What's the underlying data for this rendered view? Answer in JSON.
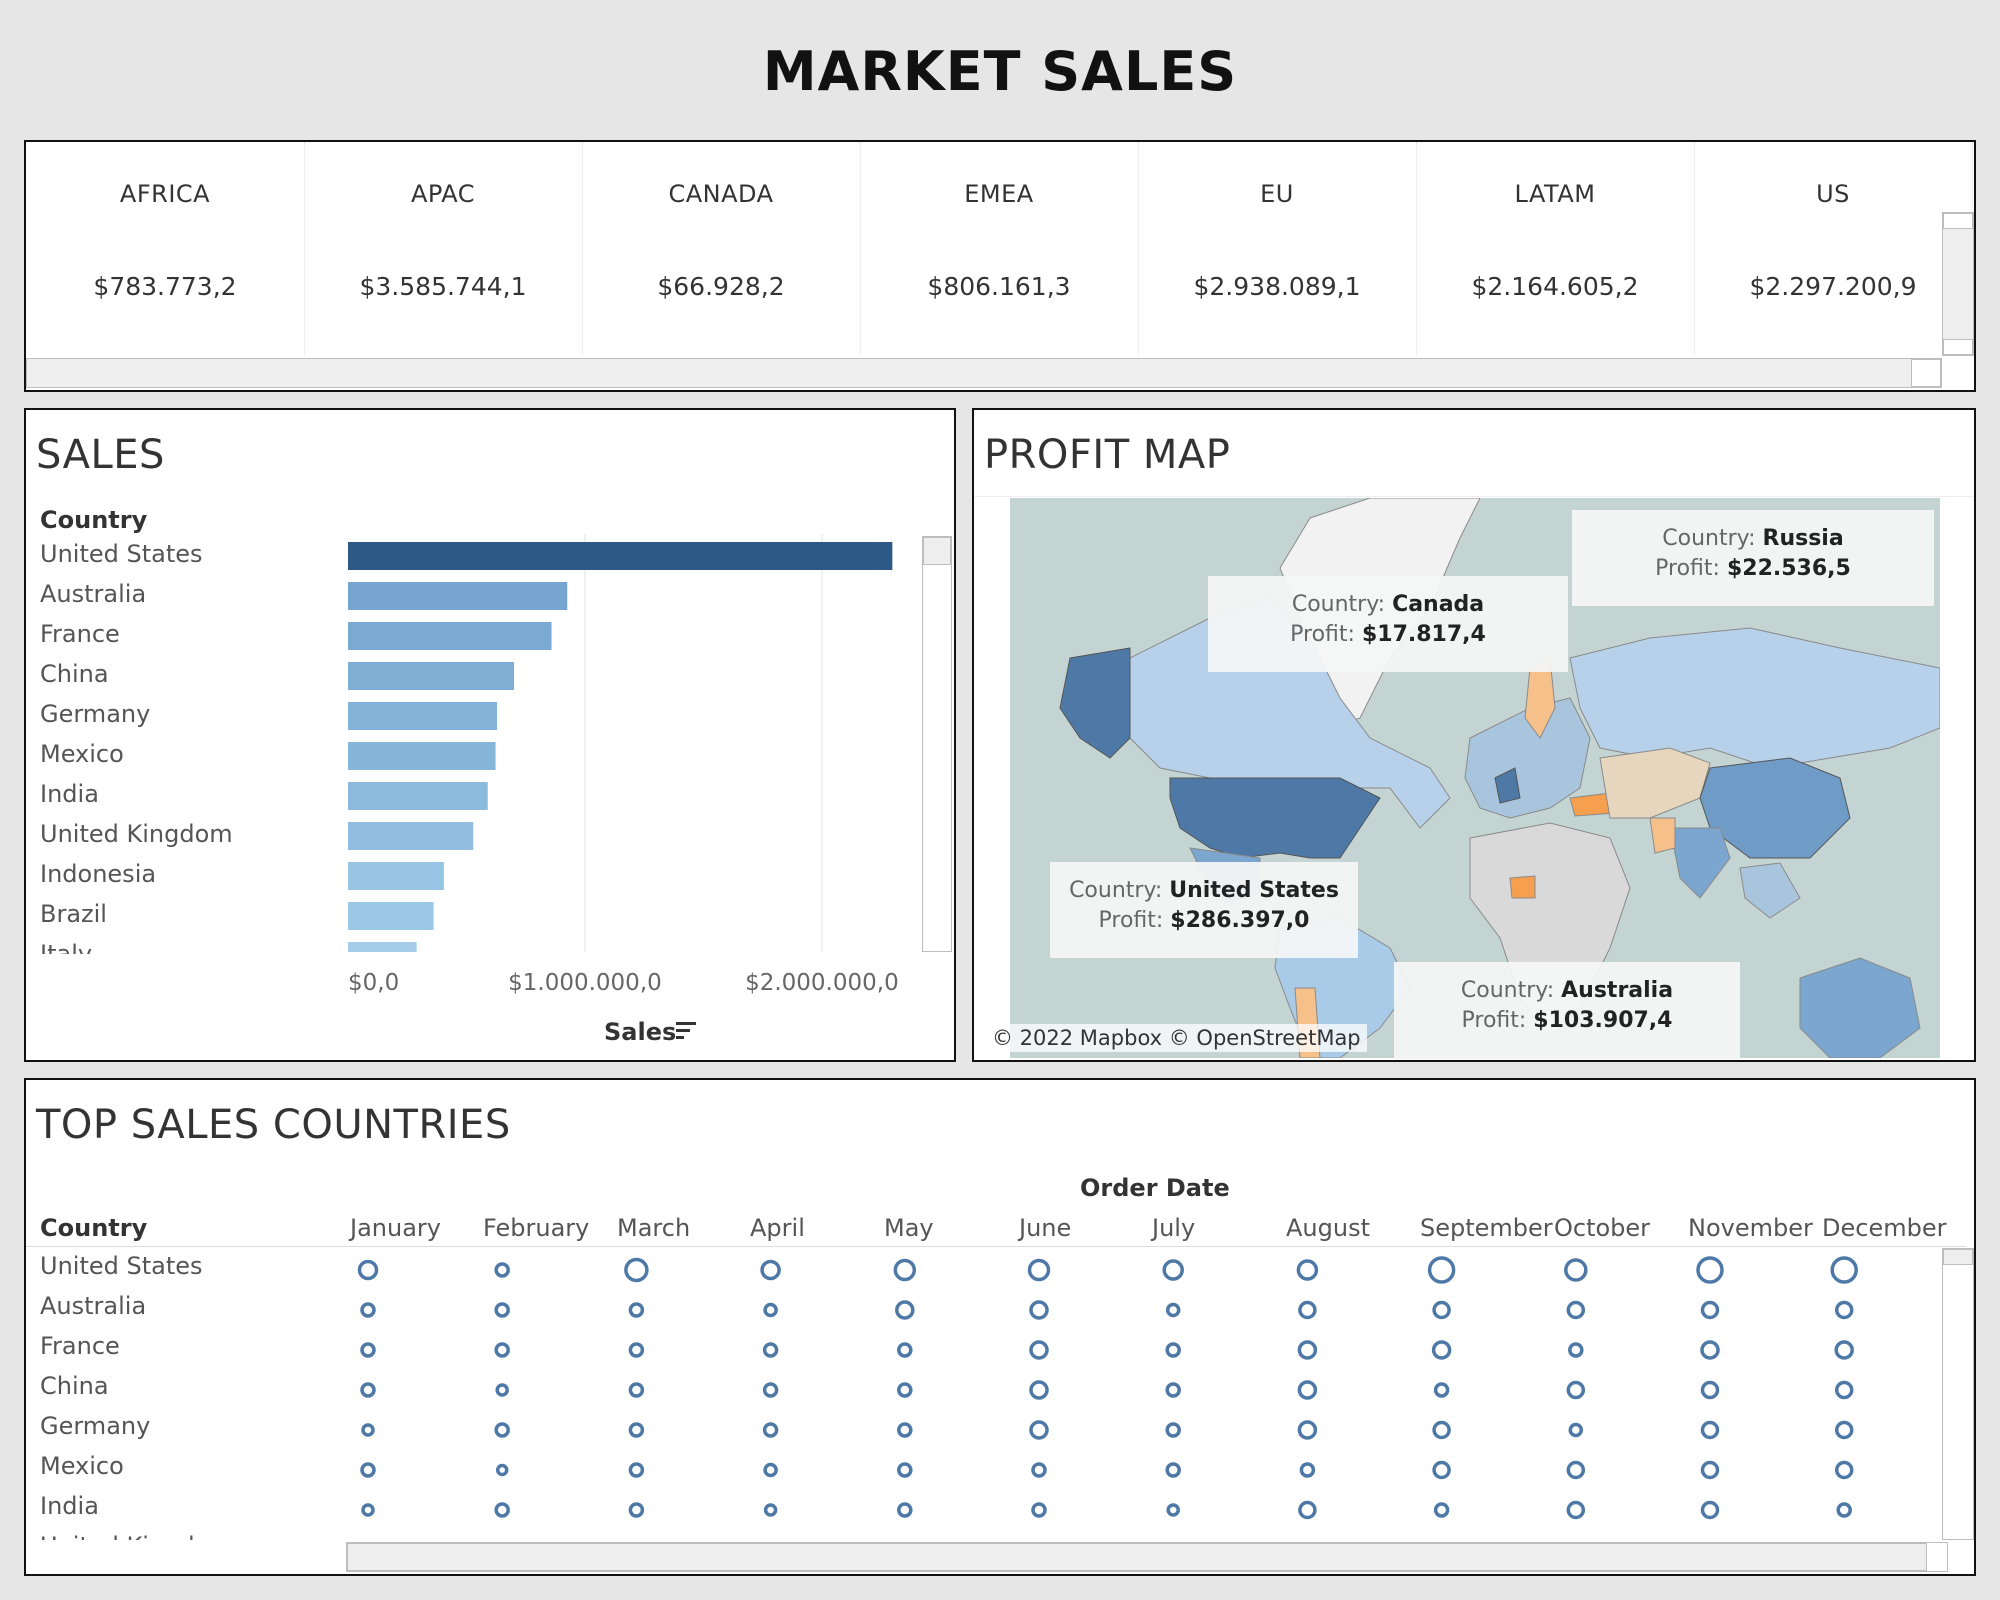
{
  "title": "MARKET SALES",
  "kpi": [
    {
      "region": "AFRICA",
      "value": "$783.773,2"
    },
    {
      "region": "APAC",
      "value": "$3.585.744,1"
    },
    {
      "region": "CANADA",
      "value": "$66.928,2"
    },
    {
      "region": "EMEA",
      "value": "$806.161,3"
    },
    {
      "region": "EU",
      "value": "$2.938.089,1"
    },
    {
      "region": "LATAM",
      "value": "$2.164.605,2"
    },
    {
      "region": "US",
      "value": "$2.297.200,9"
    }
  ],
  "sales": {
    "title": "SALES",
    "column_header": "Country",
    "axis_title": "Sales",
    "sort_icon": "sort-descending-icon",
    "chart_data": {
      "type": "bar",
      "categories": [
        "United States",
        "Australia",
        "France",
        "China",
        "Germany",
        "Mexico",
        "India",
        "United Kingdom",
        "Indonesia",
        "Brazil",
        "Italy"
      ],
      "values": [
        2297201,
        925236,
        858931,
        700562,
        628840,
        622591,
        589650,
        528576,
        404888,
        361107,
        289709
      ],
      "xlabel": "Sales",
      "xlim": [
        0,
        2300000
      ],
      "ticks": [
        "$0,0",
        "$1.000.000,0",
        "$2.000.000,0"
      ],
      "tick_values": [
        0,
        1000000,
        2000000
      ],
      "bar_colors": [
        "#2c5985",
        "#76a6cf",
        "#7aa9d2",
        "#80afd6",
        "#84b3d9",
        "#86b5da",
        "#8bbadd",
        "#90bde0",
        "#99c5e5",
        "#9cc8e7",
        "#a5cdea"
      ]
    }
  },
  "map": {
    "title": "PROFIT MAP",
    "credit": "© 2022 Mapbox © OpenStreetMap",
    "tooltips": [
      {
        "country_label": "Country:",
        "country": "Russia",
        "profit_label": "Profit:",
        "profit": "$22.536,5"
      },
      {
        "country_label": "Country:",
        "country": "Canada",
        "profit_label": "Profit:",
        "profit": "$17.817,4"
      },
      {
        "country_label": "Country:",
        "country": "United States",
        "profit_label": "Profit:",
        "profit": "$286.397,0"
      },
      {
        "country_label": "Country:",
        "country": "Australia",
        "profit_label": "Profit:",
        "profit": "$103.907,4"
      }
    ],
    "colors": {
      "ocean": "#c3d4d2",
      "land": "#d9d9d9",
      "high": "#4e79a7",
      "mid": "#a3c4e2",
      "loss": "#f59f4f"
    }
  },
  "top_sales": {
    "title": "TOP SALES COUNTRIES",
    "column_header": "Country",
    "date_header": "Order Date",
    "months": [
      "January",
      "February",
      "March",
      "April",
      "May",
      "June",
      "July",
      "August",
      "September",
      "October",
      "November",
      "December"
    ],
    "countries": [
      "United States",
      "Australia",
      "France",
      "China",
      "Germany",
      "Mexico",
      "India",
      "United Kingdom"
    ],
    "chart_data": {
      "type": "scatter",
      "rows": [
        "United States",
        "Australia",
        "France",
        "China",
        "Germany",
        "Mexico",
        "India"
      ],
      "columns": [
        "January",
        "February",
        "March",
        "April",
        "May",
        "June",
        "July",
        "August",
        "September",
        "October",
        "November",
        "December"
      ],
      "relative_size": [
        [
          0.55,
          0.3,
          0.75,
          0.55,
          0.65,
          0.65,
          0.6,
          0.6,
          0.9,
          0.7,
          0.9,
          0.9
        ],
        [
          0.3,
          0.3,
          0.3,
          0.25,
          0.5,
          0.5,
          0.25,
          0.45,
          0.45,
          0.45,
          0.45,
          0.45
        ],
        [
          0.3,
          0.3,
          0.3,
          0.3,
          0.3,
          0.5,
          0.3,
          0.5,
          0.5,
          0.3,
          0.5,
          0.5
        ],
        [
          0.3,
          0.2,
          0.3,
          0.3,
          0.3,
          0.5,
          0.3,
          0.5,
          0.3,
          0.45,
          0.45,
          0.45
        ],
        [
          0.2,
          0.3,
          0.3,
          0.3,
          0.3,
          0.5,
          0.3,
          0.5,
          0.45,
          0.25,
          0.45,
          0.45
        ],
        [
          0.3,
          0.15,
          0.3,
          0.25,
          0.3,
          0.3,
          0.3,
          0.3,
          0.45,
          0.45,
          0.45,
          0.45
        ],
        [
          0.2,
          0.3,
          0.3,
          0.2,
          0.3,
          0.3,
          0.2,
          0.45,
          0.3,
          0.45,
          0.45,
          0.3
        ]
      ],
      "color": "#4e79a7"
    }
  }
}
